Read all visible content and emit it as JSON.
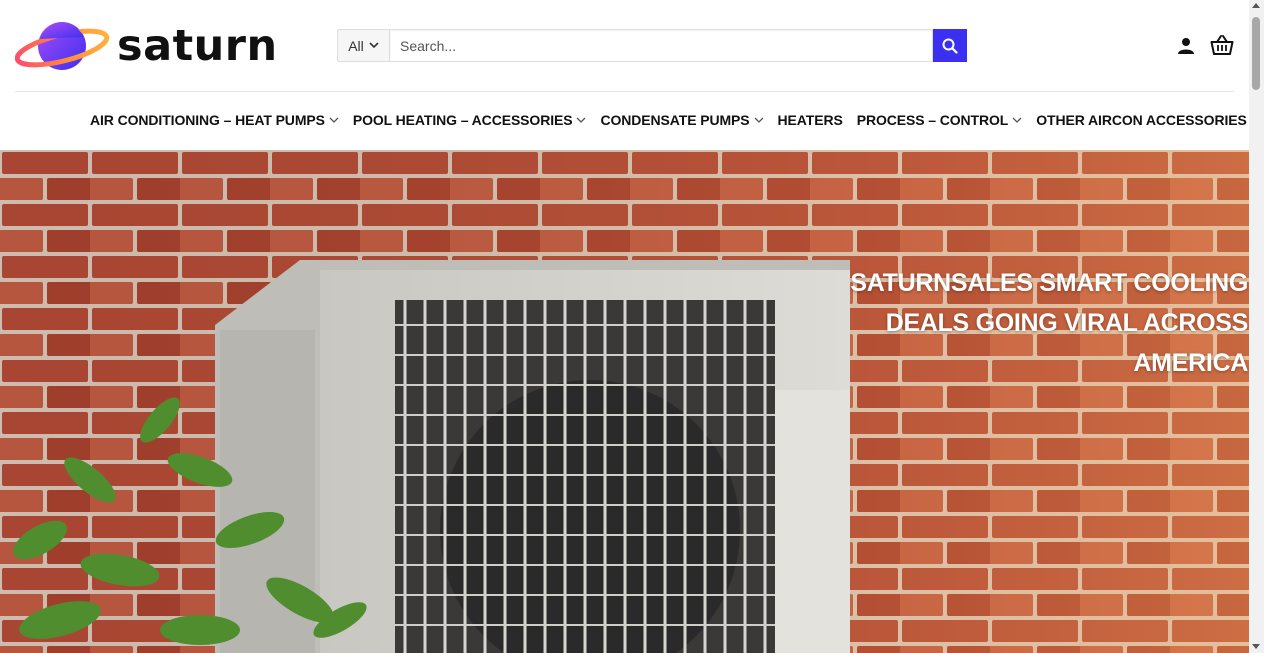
{
  "brand": {
    "name": "saturn",
    "accent": "#3b2ff0"
  },
  "search": {
    "category": "All",
    "placeholder": "Search...",
    "value": ""
  },
  "header_icons": [
    "account-icon",
    "cart-icon"
  ],
  "nav": {
    "items": [
      {
        "label": "AIR CONDITIONING – HEAT PUMPS",
        "has_dropdown": true
      },
      {
        "label": "POOL HEATING – ACCESSORIES",
        "has_dropdown": true
      },
      {
        "label": "CONDENSATE PUMPS",
        "has_dropdown": true
      },
      {
        "label": "HEATERS",
        "has_dropdown": false
      },
      {
        "label": "PROCESS – CONTROL",
        "has_dropdown": true
      },
      {
        "label": "OTHER AIRCON ACCESSORIES",
        "has_dropdown": true
      }
    ]
  },
  "hero": {
    "title_lines": [
      "SATURNSALES SMART COOLING",
      "DEALS GOING VIRAL ACROSS",
      "AMERICA"
    ]
  }
}
